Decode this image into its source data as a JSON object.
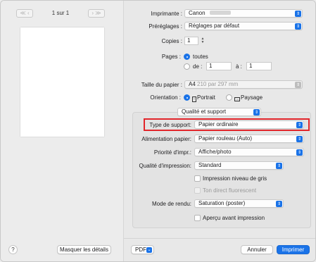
{
  "left": {
    "page_counter": "1 sur 1",
    "nav_first_prev": "≪ ‹",
    "nav_next_last": "› ≫",
    "help_label": "?",
    "hide_details_label": "Masquer les détails"
  },
  "settings": {
    "printer": {
      "label": "Imprimante :",
      "value": "Canon"
    },
    "presets": {
      "label": "Préréglages :",
      "value": "Réglages par défaut"
    },
    "copies": {
      "label": "Copies :",
      "value": "1"
    },
    "pages": {
      "label": "Pages :",
      "all_label": "toutes",
      "from_label": "de :",
      "from_value": "1",
      "to_label": "à :",
      "to_value": "1"
    },
    "paper_size": {
      "label": "Taille du papier :",
      "value": "A4",
      "detail": "210 par 297 mm"
    },
    "orientation": {
      "label": "Orientation :",
      "portrait": "Portrait",
      "landscape": "Paysage"
    },
    "section": {
      "value": "Qualité et support"
    },
    "media_type": {
      "label": "Type de support:",
      "value": "Papier ordinaire"
    },
    "paper_source": {
      "label": "Alimentation papier:",
      "value": "Papier rouleau (Auto)"
    },
    "print_priority": {
      "label": "Priorité d'impr.:",
      "value": "Affiche/photo"
    },
    "print_quality": {
      "label": "Qualité d'impression:",
      "value": "Standard"
    },
    "grayscale": {
      "label": "Impression niveau de gris"
    },
    "fluorescent": {
      "label": "Ton direct fluorescent"
    },
    "render_mode": {
      "label": "Mode de rendu:",
      "value": "Saturation (poster)"
    },
    "preview_label": "Aperçu avant impression"
  },
  "footer": {
    "pdf_label": "PDF",
    "cancel_label": "Annuler",
    "print_label": "Imprimer"
  },
  "colors": {
    "accent": "#1a73e8",
    "highlight_border": "#e2262b"
  }
}
